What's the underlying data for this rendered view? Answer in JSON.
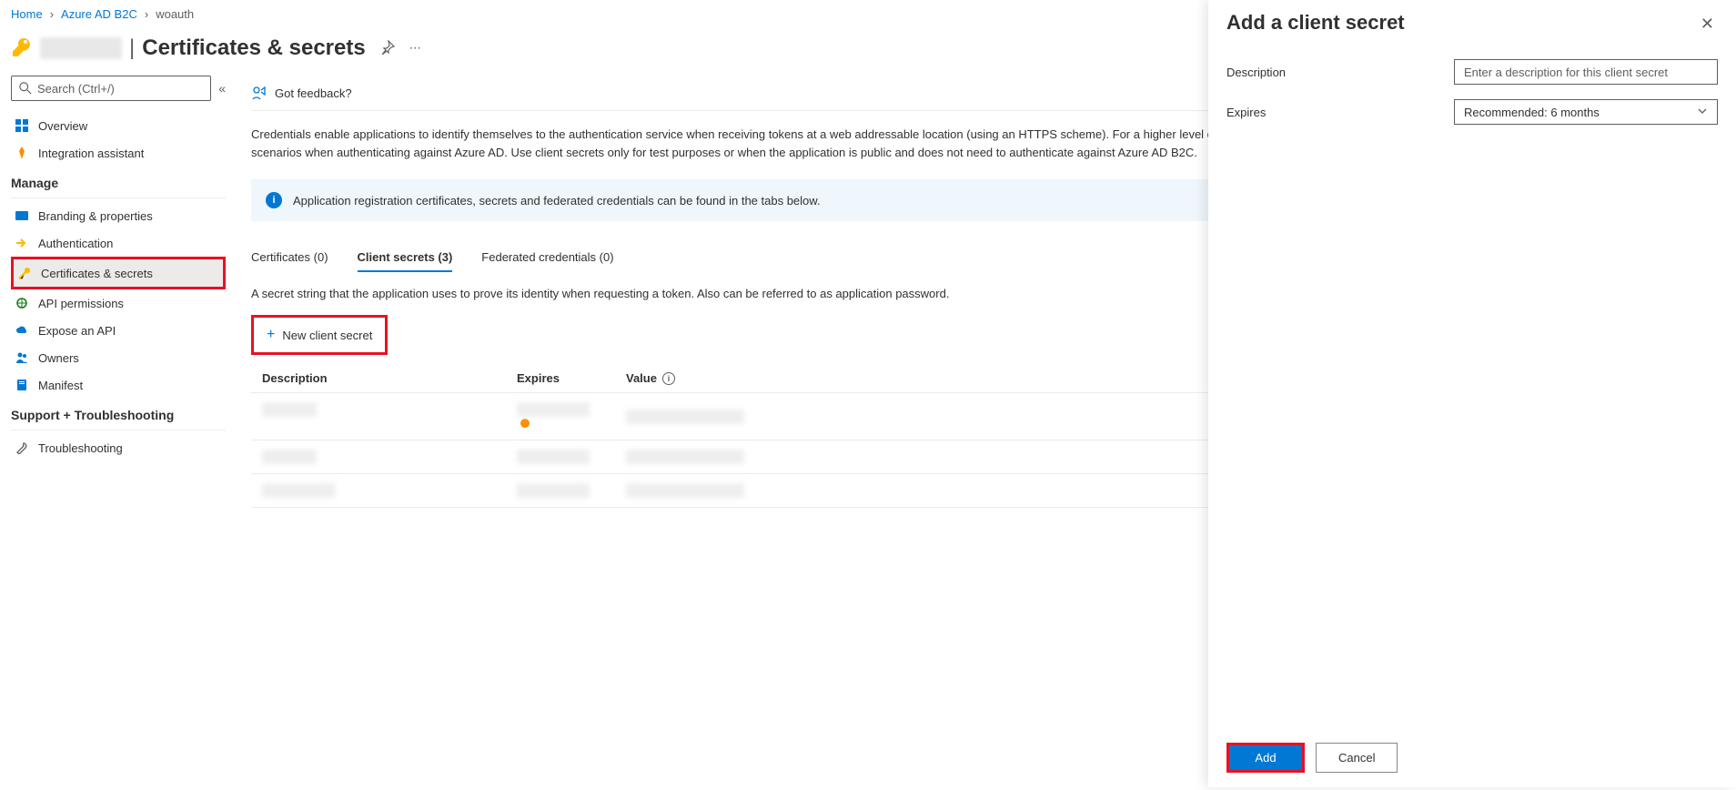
{
  "breadcrumb": {
    "home": "Home",
    "level1": "Azure AD B2C",
    "current": "woauth"
  },
  "header": {
    "title": "Certificates & secrets"
  },
  "sidebar": {
    "search_placeholder": "Search (Ctrl+/)",
    "items_top": [
      {
        "label": "Overview"
      },
      {
        "label": "Integration assistant"
      }
    ],
    "section_manage": "Manage",
    "items_manage": [
      {
        "label": "Branding & properties"
      },
      {
        "label": "Authentication"
      },
      {
        "label": "Certificates & secrets"
      },
      {
        "label": "API permissions"
      },
      {
        "label": "Expose an API"
      },
      {
        "label": "Owners"
      },
      {
        "label": "Manifest"
      }
    ],
    "section_support": "Support + Troubleshooting",
    "items_support": [
      {
        "label": "Troubleshooting"
      }
    ]
  },
  "main": {
    "feedback": "Got feedback?",
    "description": "Credentials enable applications to identify themselves to the authentication service when receiving tokens at a web addressable location (using an HTTPS scheme). For a higher level of assurance, we recommend using a certificate instead of a client secret for client credential scenarios when authenticating against Azure AD. Use client secrets only for test purposes or when the application is public and does not need to authenticate against Azure AD B2C.",
    "info_banner": "Application registration certificates, secrets and federated credentials can be found in the tabs below.",
    "tabs": [
      {
        "label": "Certificates (0)"
      },
      {
        "label": "Client secrets (3)"
      },
      {
        "label": "Federated credentials (0)"
      }
    ],
    "tab_description": "A secret string that the application uses to prove its identity when requesting a token. Also can be referred to as application password.",
    "new_secret_label": "New client secret",
    "table": {
      "col_description": "Description",
      "col_expires": "Expires",
      "col_value": "Value"
    }
  },
  "panel": {
    "title": "Add a client secret",
    "description_label": "Description",
    "description_placeholder": "Enter a description for this client secret",
    "expires_label": "Expires",
    "expires_value": "Recommended: 6 months",
    "add_button": "Add",
    "cancel_button": "Cancel"
  }
}
